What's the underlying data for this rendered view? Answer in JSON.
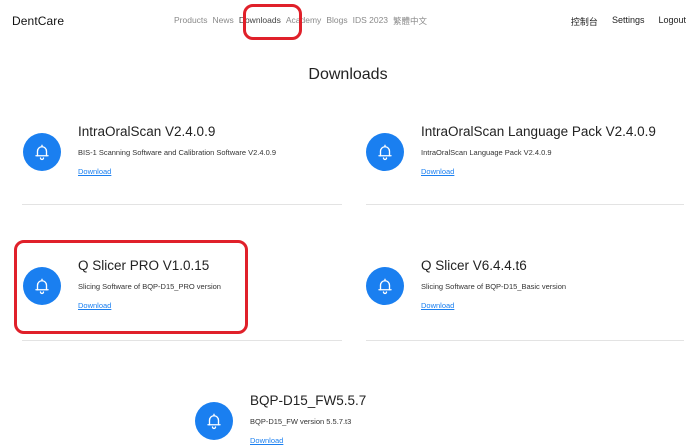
{
  "header": {
    "brand": "DentCare",
    "nav": [
      {
        "label": "Products"
      },
      {
        "label": "News"
      },
      {
        "label": "Downloads"
      },
      {
        "label": "Academy"
      },
      {
        "label": "Blogs"
      },
      {
        "label": "IDS 2023"
      },
      {
        "label": "繁體中文"
      }
    ],
    "right": [
      {
        "label": "控制台"
      },
      {
        "label": "Settings"
      },
      {
        "label": "Logout"
      }
    ]
  },
  "page_title": "Downloads",
  "downloads": [
    {
      "name": "IntraOralScan V2.4.0.9",
      "description": "BIS-1 Scanning Software and Calibration Software V2.4.0.9",
      "link": "Download"
    },
    {
      "name": "IntraOralScan Language Pack V2.4.0.9",
      "description": "IntraOralScan Language Pack V2.4.0.9",
      "link": "Download"
    },
    {
      "name": "Q Slicer PRO V1.0.15",
      "description": "Slicing Software of BQP-D15_PRO version",
      "link": "Download"
    },
    {
      "name": "Q Slicer V6.4.4.t6",
      "description": "Slicing Software of BQP-D15_Basic version",
      "link": "Download"
    },
    {
      "name": "BQP-D15_FW5.5.7",
      "description": "BQP-D15_FW version 5.5.7.t3",
      "link": "Download"
    }
  ],
  "colors": {
    "accent": "#1a7ff0",
    "highlight": "#e0202a"
  }
}
